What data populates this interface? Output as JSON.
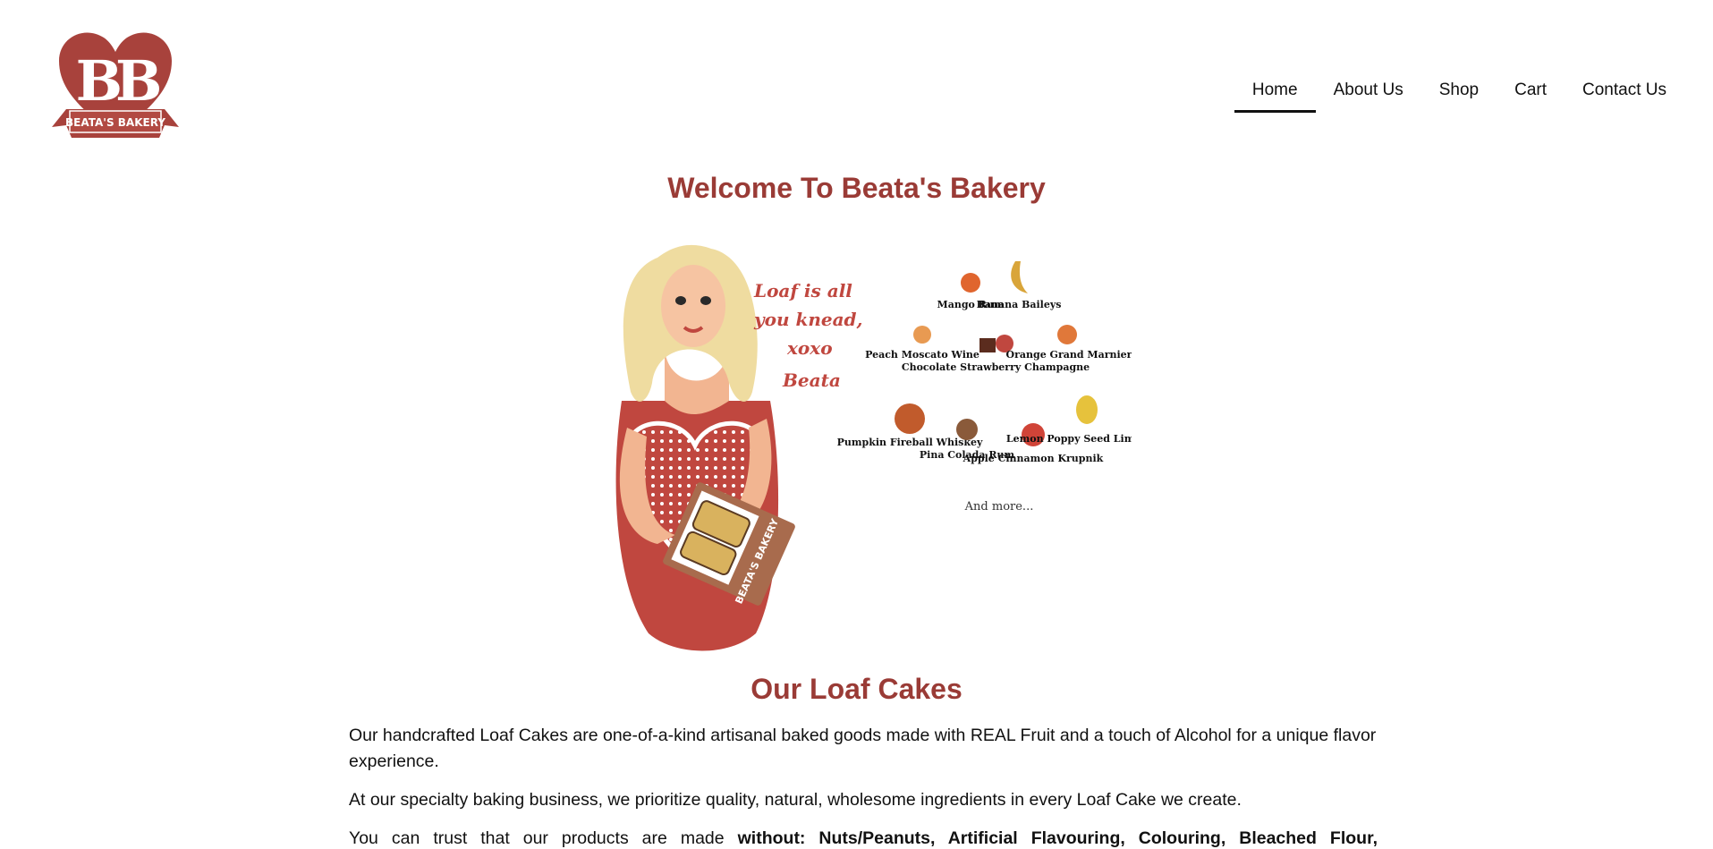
{
  "nav": {
    "items": [
      {
        "label": "Home",
        "active": true
      },
      {
        "label": "About Us",
        "active": false
      },
      {
        "label": "Shop",
        "active": false
      },
      {
        "label": "Cart",
        "active": false
      },
      {
        "label": "Contact Us",
        "active": false
      }
    ]
  },
  "logo": {
    "text": "BEATA'S BAKERY",
    "monogram": "BB"
  },
  "hero": {
    "welcome_title": "Welcome To Beata's Bakery",
    "signature_lines": [
      "Loaf is all",
      "you knead,",
      "xoxo",
      "Beata"
    ],
    "box_label": "BEATA'S BAKERY",
    "flavors": [
      "Mango Rum",
      "Banana Baileys",
      "Peach Moscato Wine",
      "Chocolate Strawberry Champagne",
      "Orange Grand Marnier",
      "Pumpkin Fireball Whiskey",
      "Pina Colada Rum",
      "Apple Cinnamon Krupnik",
      "Lemon Poppy Seed Limoncello"
    ],
    "and_more": "And more..."
  },
  "section": {
    "title": "Our Loaf Cakes",
    "p1": "Our handcrafted Loaf Cakes are one-of-a-kind artisanal baked goods made with REAL Fruit and a touch of Alcohol for a unique flavor experience.",
    "p2": "At our specialty baking business, we prioritize quality, natural, wholesome ingredients in every Loaf Cake we create.",
    "p3_lead": "You can trust that our products are made ",
    "p3_bold": "without: Nuts/Peanuts, Artificial Flavouring, Colouring, Bleached Flour,"
  },
  "colors": {
    "accent": "#9a3b36",
    "apron_red": "#c0473f",
    "hair": "#efdca0"
  }
}
